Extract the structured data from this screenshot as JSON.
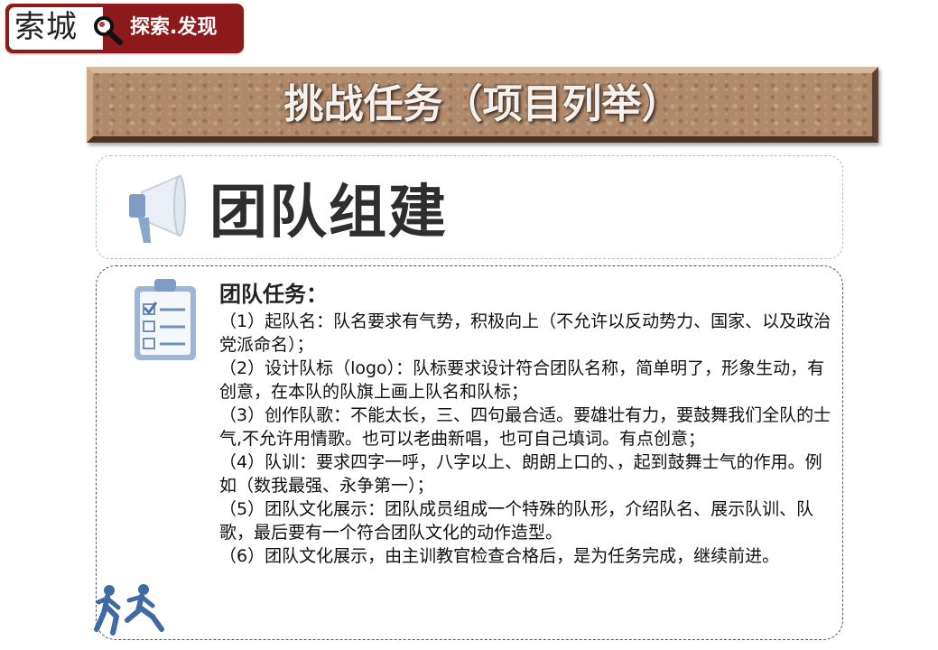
{
  "logo": {
    "main_text": "索城",
    "slogan": "探索.发现",
    "brand_color": "#8c1a1a",
    "icon": "magnifier-icon"
  },
  "banner": {
    "title": "挑战任务（项目列举）"
  },
  "section": {
    "title": "团队组建",
    "icon": "megaphone-icon"
  },
  "content": {
    "icon": "clipboard-checklist-icon",
    "heading": "团队任务：",
    "items": [
      "（1）起队名：队名要求有气势，积极向上（不允许以反动势力、国家、以及政治党派命名）；",
      "（2）设计队标（logo）：队标要求设计符合团队名称，简单明了，形象生动，有创意，在本队的队旗上画上队名和队标；",
      "（3）创作队歌：不能太长，三、四句最合适。要雄壮有力，要鼓舞我们全队的士气,不允许用情歌。也可以老曲新唱，也可自己填词。有点创意；",
      "（4）队训：要求四字一呼，八字以上、朗朗上口的、，起到鼓舞士气的作用。例如（数我最强、永争第一）；",
      "（5）团队文化展示：团队成员组成一个特殊的队形，介绍队名、展示队训、队歌，最后要有一个符合团队文化的动作造型。",
      "（6）团队文化展示，由主训教官检查合格后，是为任务完成，继续前进。"
    ],
    "footer_icon": "running-people-icon"
  }
}
